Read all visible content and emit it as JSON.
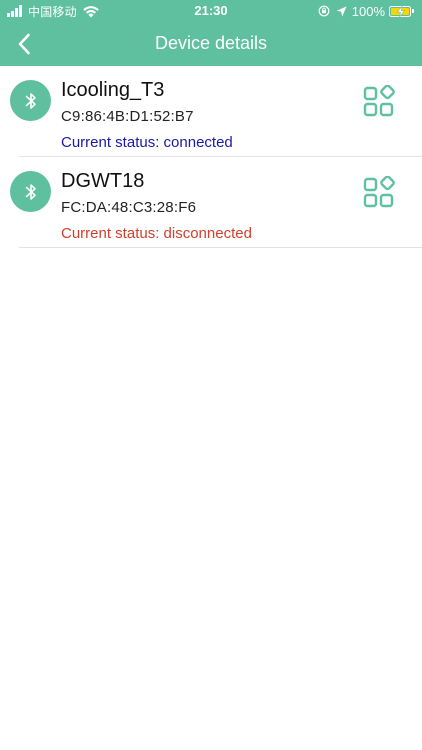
{
  "status_bar": {
    "carrier": "中国移动",
    "time": "21:30",
    "battery_percent": "100%",
    "icons": [
      "signal-icon",
      "wifi-icon",
      "rotation-lock-icon",
      "location-icon",
      "battery-charging-icon"
    ]
  },
  "nav": {
    "title": "Device details",
    "back_icon": "chevron-left-icon"
  },
  "colors": {
    "accent": "#5ec09f",
    "status_connected": "#1a1aa8",
    "status_disconnected": "#d1402a",
    "battery_fill": "#ffd300"
  },
  "devices": [
    {
      "name": "Icooling_T3",
      "mac": "C9:86:4B:D1:52:B7",
      "status": "Current status: connected",
      "icon": "bluetooth-icon",
      "action_icon": "apps-grid-icon"
    },
    {
      "name": "DGWT18",
      "mac": "FC:DA:48:C3:28:F6",
      "status": "Current status: disconnected",
      "icon": "bluetooth-icon",
      "action_icon": "apps-grid-icon"
    }
  ]
}
